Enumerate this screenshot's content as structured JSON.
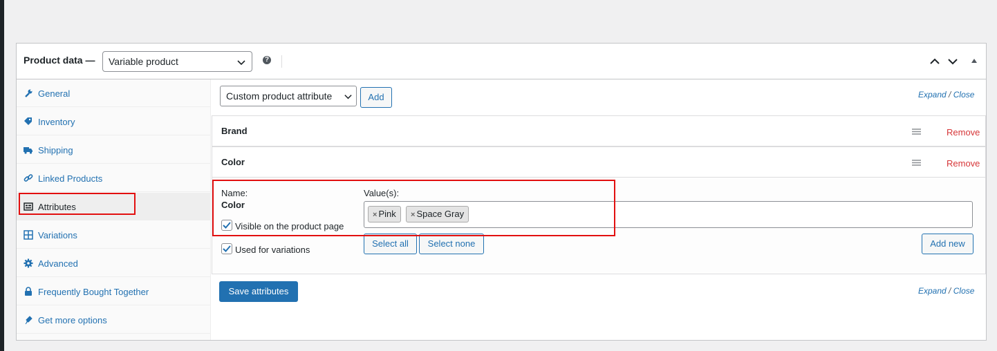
{
  "header": {
    "title": "Product data —",
    "product_type": "Variable product",
    "help_icon": "help-icon",
    "controls": [
      "move-up-icon",
      "move-down-icon",
      "toggle-panel-icon"
    ]
  },
  "tabs": [
    {
      "label": "General",
      "icon": "wrench-icon"
    },
    {
      "label": "Inventory",
      "icon": "tag-icon"
    },
    {
      "label": "Shipping",
      "icon": "truck-icon"
    },
    {
      "label": "Linked Products",
      "icon": "link-icon"
    },
    {
      "label": "Attributes",
      "icon": "list-view-icon",
      "active": true
    },
    {
      "label": "Variations",
      "icon": "grid-icon"
    },
    {
      "label": "Advanced",
      "icon": "gear-icon"
    },
    {
      "label": "Frequently Bought Together",
      "icon": "lock-icon"
    },
    {
      "label": "Get more options",
      "icon": "plugin-icon"
    }
  ],
  "attributes": {
    "select_value": "Custom product attribute",
    "add_label": "Add",
    "expand_label": "Expand",
    "separator": "/",
    "close_label": "Close",
    "rows": [
      {
        "name": "Brand",
        "remove": "Remove"
      },
      {
        "name": "Color",
        "remove": "Remove"
      }
    ],
    "detail": {
      "name_label": "Name:",
      "name_value": "Color",
      "values_label": "Value(s):",
      "values": [
        "Pink",
        "Space Gray"
      ],
      "chip_remove": "×",
      "visible_label": "Visible on the product page",
      "visible_checked": true,
      "variations_label": "Used for variations",
      "variations_checked": true,
      "select_all": "Select all",
      "select_none": "Select none",
      "add_new": "Add new"
    },
    "save_label": "Save attributes"
  },
  "colors": {
    "link": "#2271b1",
    "remove": "#d63638",
    "highlight": "#e20f0f",
    "primary": "#2271b1"
  }
}
